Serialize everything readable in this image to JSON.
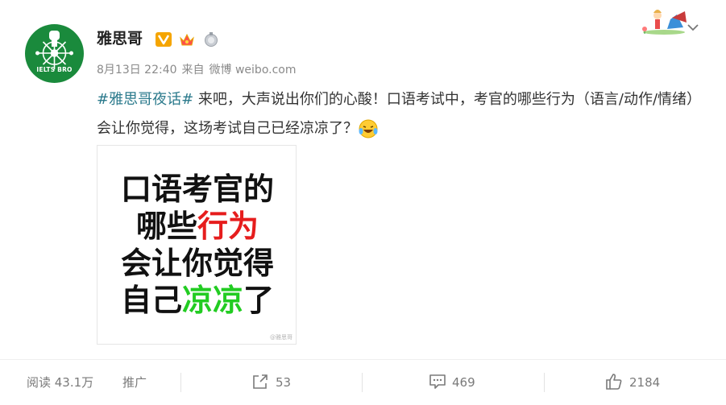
{
  "user": {
    "name": "雅思哥",
    "avatar_text": "IELTS BRO",
    "badges": [
      "verified-v-icon",
      "crown-icon",
      "silver-medal-icon"
    ]
  },
  "meta": {
    "date": "8月13日 22:40",
    "from_label": "来自",
    "source": "微博 weibo.com"
  },
  "post": {
    "hashtag": "#雅思哥夜话#",
    "text": "来吧，大声说出你们的心酸！口语考试中，考官的哪些行为（语言/动作/情绪）会让你觉得，这场考试自己已经凉凉了？",
    "emoji": "laughing-crying-emoji"
  },
  "card": {
    "line1": "口语考官的",
    "line2_black": "哪些",
    "line2_red": "行为",
    "line3": "会让你觉得",
    "line4_black_start": "自己",
    "line4_green": "凉凉",
    "line4_black_end": "了",
    "watermark": "@雅思哥"
  },
  "footer": {
    "reads": "阅读 43.1万",
    "promote": "推广",
    "reposts": "53",
    "comments": "469",
    "likes": "2184"
  },
  "colors": {
    "hashtag": "#2b7a8c",
    "avatar_bg": "#1a8a3c",
    "card_red": "#e61d1d",
    "card_green": "#22cc22",
    "verified_orange": "#f5a500"
  }
}
